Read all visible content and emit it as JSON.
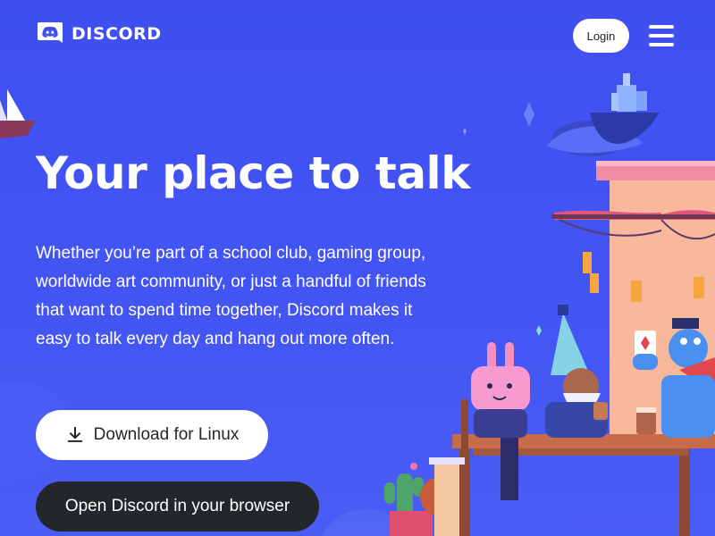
{
  "header": {
    "logo_text": "DISCORD",
    "logo_icon": "discord-logo-icon",
    "login_label": "Login",
    "menu_icon": "hamburger-menu-icon"
  },
  "hero": {
    "title": "Your place to talk",
    "description": "Whether you’re part of a school club, gaming group, worldwide art community, or just a handful of friends that want to spend time together, Discord makes it easy to talk every day and hang out more often.",
    "download_label": "Download for Linux",
    "download_icon": "download-icon",
    "browser_label": "Open Discord in your browser"
  },
  "colors": {
    "background": "#404eed",
    "button_light": "#ffffff",
    "button_dark": "#23272a"
  }
}
